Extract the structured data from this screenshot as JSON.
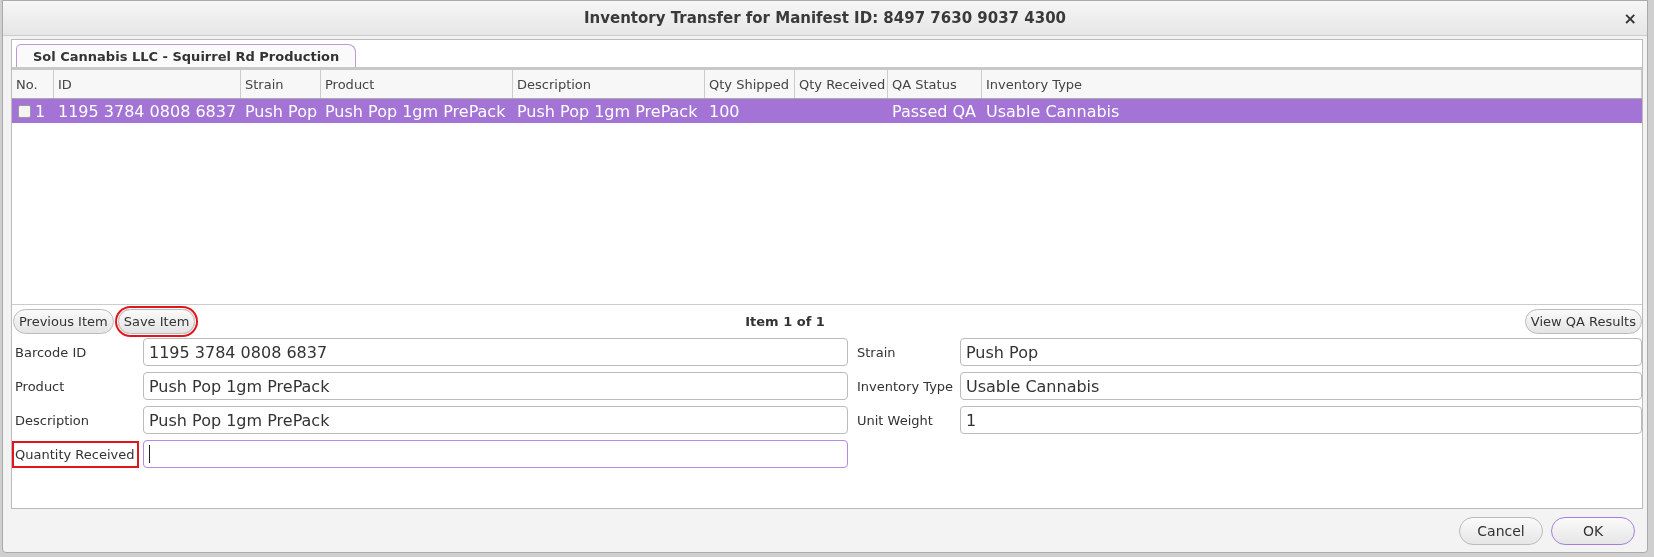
{
  "window": {
    "title": "Inventory Transfer for Manifest ID: 8497 7630 9037 4300",
    "close": "×"
  },
  "tabs": [
    {
      "label": "Sol Cannabis LLC - Squirrel Rd Production",
      "selected": true
    }
  ],
  "table": {
    "columns": [
      "No.",
      "ID",
      "Strain",
      "Product",
      "Description",
      "Qty Shipped",
      "Qty Received",
      "QA Status",
      "Inventory Type"
    ],
    "rows": [
      {
        "checked": false,
        "selected": true,
        "cells": [
          "1",
          "1195 3784 0808 6837",
          "Push Pop",
          "Push Pop 1gm PrePack",
          "Push Pop 1gm PrePack",
          "100",
          null,
          "Passed QA",
          "Usable Cannabis"
        ]
      }
    ]
  },
  "nav": {
    "buttons": [
      {
        "label": "Previous Item",
        "highlighted": false
      },
      {
        "label": "Save Item",
        "highlighted": true
      }
    ],
    "position": "Item 1 of 1",
    "right_button": "View QA Results"
  },
  "form": {
    "left": [
      {
        "label": "Barcode ID",
        "value": "1195 3784 0808 6837",
        "highlighted": false,
        "focused": false
      },
      {
        "label": "Product",
        "value": "Push Pop 1gm PrePack",
        "highlighted": false,
        "focused": false
      },
      {
        "label": "Description",
        "value": "Push Pop 1gm PrePack",
        "highlighted": false,
        "focused": false
      },
      {
        "label": "Quantity Received",
        "highlighted": true,
        "focused": true
      }
    ],
    "right": [
      {
        "label": "Strain",
        "value": "Push Pop",
        "highlighted": false,
        "focused": false
      },
      {
        "label": "Inventory Type",
        "value": "Usable Cannabis",
        "highlighted": false,
        "focused": false
      },
      {
        "label": "Unit Weight",
        "value": "1",
        "highlighted": false,
        "focused": false
      }
    ]
  },
  "footer": [
    {
      "label": "Cancel",
      "default": false
    },
    {
      "label": "OK",
      "default": true
    }
  ]
}
